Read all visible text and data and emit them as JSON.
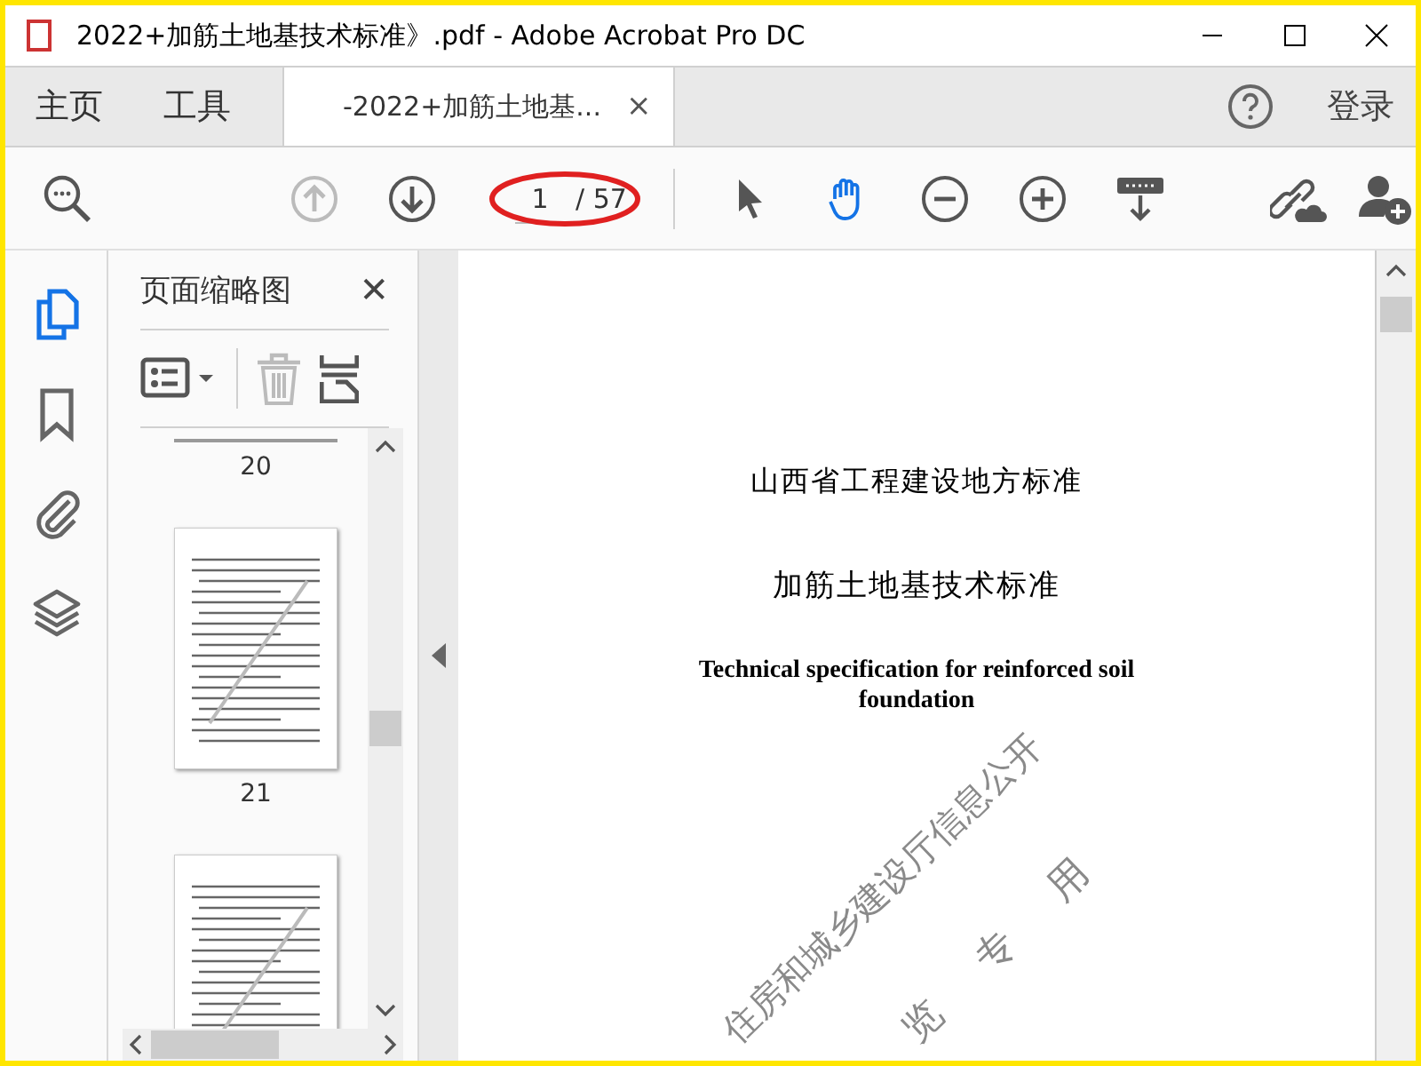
{
  "window": {
    "title": "2022+加筋土地基技术标准》.pdf - Adobe Acrobat Pro DC"
  },
  "tabs": [
    {
      "label": "主页",
      "selected": false
    },
    {
      "label": "工具",
      "selected": false
    },
    {
      "label": "-2022+加筋土地基...",
      "selected": true,
      "close": "×"
    }
  ],
  "sign_in": "登录",
  "toolbar": {
    "nav": [
      {
        "kind": "up",
        "disabled": true
      },
      {
        "kind": "down",
        "disabled": false
      }
    ],
    "page_field": {
      "value": "1",
      "total": "/ 57"
    },
    "tools": [
      {
        "kind": "pointer",
        "selected": false
      },
      {
        "kind": "hand",
        "selected": true
      },
      {
        "kind": "zoom-out",
        "selected": false
      },
      {
        "kind": "zoom-in",
        "selected": false
      },
      {
        "kind": "keyboard",
        "selected": false
      }
    ],
    "share": [
      {
        "kind": "link-cloud"
      },
      {
        "kind": "add-user"
      }
    ]
  },
  "side_rail": [
    {
      "kind": "pages",
      "selected": true
    },
    {
      "kind": "bookmark",
      "selected": false
    },
    {
      "kind": "attachment",
      "selected": false
    },
    {
      "kind": "layers",
      "selected": false
    }
  ],
  "thumbnail_panel": {
    "title": "页面缩略图",
    "close": "✕",
    "tools": [
      {
        "kind": "options",
        "disabled": false
      },
      {
        "kind": "delete",
        "disabled": true
      },
      {
        "kind": "extract",
        "disabled": false
      }
    ],
    "pages": [
      {
        "label": "20"
      },
      {
        "label": "21"
      }
    ]
  },
  "document": {
    "lines": [
      {
        "kind": "cn",
        "text": "山西省工程建设地方标准"
      },
      {
        "kind": "cn",
        "text": "加筋土地基技术标准"
      },
      {
        "kind": "en",
        "text": "Technical specification for reinforced soil foundation"
      }
    ],
    "watermark": [
      "住房和城乡建设厅信息公开",
      "览 专 用"
    ]
  }
}
